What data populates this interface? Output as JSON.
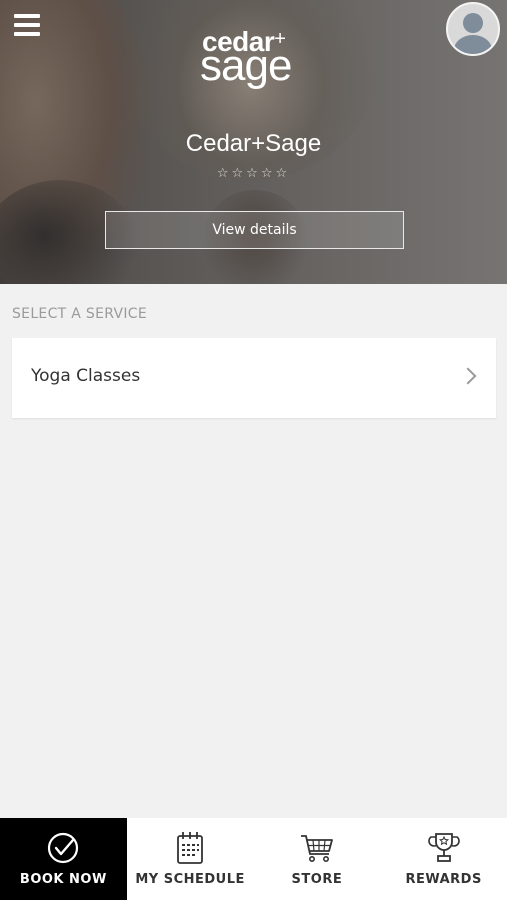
{
  "header": {
    "menu_icon": "hamburger-menu-icon",
    "logo": {
      "line1": "cedar",
      "plus": "+",
      "line2": "sage"
    },
    "avatar_icon": "user-avatar-icon"
  },
  "studio": {
    "name": "Cedar+Sage",
    "rating_display": "☆☆☆☆☆",
    "rating_value": 0,
    "rating_max": 5,
    "details_label": "View details"
  },
  "services": {
    "heading": "SELECT A SERVICE",
    "items": [
      {
        "label": "Yoga Classes",
        "icon": "chevron-right-icon"
      }
    ]
  },
  "bottom_nav": {
    "items": [
      {
        "label": "BOOK NOW",
        "icon": "check-circle-icon",
        "active": true
      },
      {
        "label": "MY SCHEDULE",
        "icon": "calendar-icon",
        "active": false
      },
      {
        "label": "STORE",
        "icon": "shopping-cart-icon",
        "active": false
      },
      {
        "label": "REWARDS",
        "icon": "trophy-icon",
        "active": false
      }
    ]
  },
  "colors": {
    "active_tab_bg": "#000000",
    "page_bg": "#f1f1f1",
    "card_bg": "#ffffff",
    "muted_text": "#9a9a9a"
  }
}
